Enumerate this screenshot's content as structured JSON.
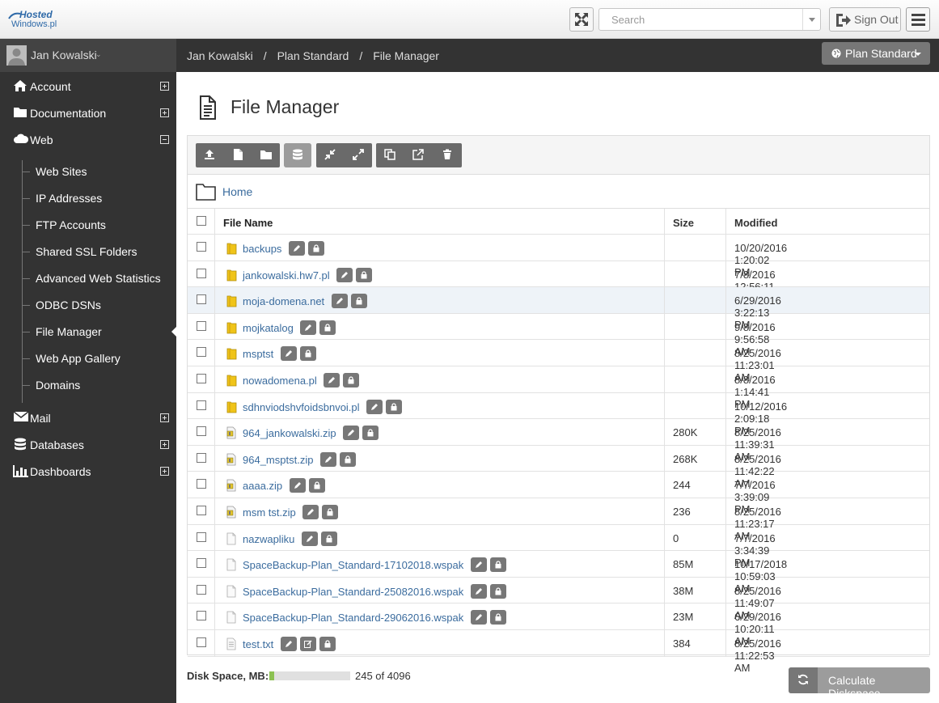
{
  "brand": {
    "line1": "Hosted",
    "line2": "Windows.pl"
  },
  "topbar": {
    "search_placeholder": "Search",
    "signout_label": "Sign Out"
  },
  "user": {
    "name": "Jan Kowalski"
  },
  "nav": {
    "account": "Account",
    "documentation": "Documentation",
    "web": "Web",
    "mail": "Mail",
    "databases": "Databases",
    "dashboards": "Dashboards"
  },
  "web_sub": [
    "Web Sites",
    "IP Addresses",
    "FTP Accounts",
    "Shared SSL Folders",
    "Advanced Web Statistics",
    "ODBC DSNs",
    "File Manager",
    "Web App Gallery",
    "Domains"
  ],
  "breadcrumb": {
    "c1": "Jan Kowalski",
    "c2": "Plan Standard",
    "c3": "File Manager",
    "sep": "/"
  },
  "plan_button": "Plan Standard",
  "page_title": "File Manager",
  "path": {
    "home": "Home"
  },
  "table": {
    "headers": {
      "name": "File Name",
      "size": "Size",
      "modified": "Modified"
    },
    "rows": [
      {
        "name": "backups",
        "type": "folder",
        "size": "",
        "modified": "10/20/2016 1:20:02 PM"
      },
      {
        "name": "jankowalski.hw7.pl",
        "type": "folder",
        "size": "",
        "modified": "7/8/2016 12:56:11 PM"
      },
      {
        "name": "moja-domena.net",
        "type": "folder",
        "size": "",
        "modified": "6/29/2016 3:22:13 PM"
      },
      {
        "name": "mojkatalog",
        "type": "folder",
        "size": "",
        "modified": "9/8/2016 9:56:58 AM"
      },
      {
        "name": "msptst",
        "type": "folder",
        "size": "",
        "modified": "8/25/2016 11:23:01 AM"
      },
      {
        "name": "nowadomena.pl",
        "type": "folder",
        "size": "",
        "modified": "8/8/2016 1:14:41 PM"
      },
      {
        "name": "sdhnviodshvfoidsbnvoi.pl",
        "type": "folder",
        "size": "",
        "modified": "10/12/2016 2:09:18 PM"
      },
      {
        "name": "964_jankowalski.zip",
        "type": "zip",
        "size": "280K",
        "modified": "8/25/2016 11:39:31 AM"
      },
      {
        "name": "964_msptst.zip",
        "type": "zip",
        "size": "268K",
        "modified": "8/25/2016 11:42:22 AM"
      },
      {
        "name": "aaaa.zip",
        "type": "zip",
        "size": "244",
        "modified": "7/7/2016 3:39:09 PM"
      },
      {
        "name": "msm tst.zip",
        "type": "zip",
        "size": "236",
        "modified": "8/25/2016 11:23:17 AM"
      },
      {
        "name": "nazwapliku",
        "type": "file",
        "size": "0",
        "modified": "7/7/2016 3:34:39 PM"
      },
      {
        "name": "SpaceBackup-Plan_Standard-17102018.wspak",
        "type": "file",
        "size": "85M",
        "modified": "10/17/2018 10:59:03 AM"
      },
      {
        "name": "SpaceBackup-Plan_Standard-25082016.wspak",
        "type": "file",
        "size": "38M",
        "modified": "8/25/2016 11:49:07 AM"
      },
      {
        "name": "SpaceBackup-Plan_Standard-29062016.wspak",
        "type": "file",
        "size": "23M",
        "modified": "6/29/2016 10:20:11 AM"
      },
      {
        "name": "test.txt",
        "type": "text",
        "size": "384",
        "modified": "8/25/2016 11:22:53 AM"
      }
    ]
  },
  "disk": {
    "label": "Disk Space, MB:",
    "used": 245,
    "total": 4096,
    "text": "245 of 4096"
  },
  "calc_label": "Calculate Diskspace",
  "colors": {
    "sidebar": "#333333",
    "link": "#3b6c9e",
    "folder": "#f0c419",
    "progress": "#8cc152",
    "highlight_row": "#eef3f8"
  }
}
